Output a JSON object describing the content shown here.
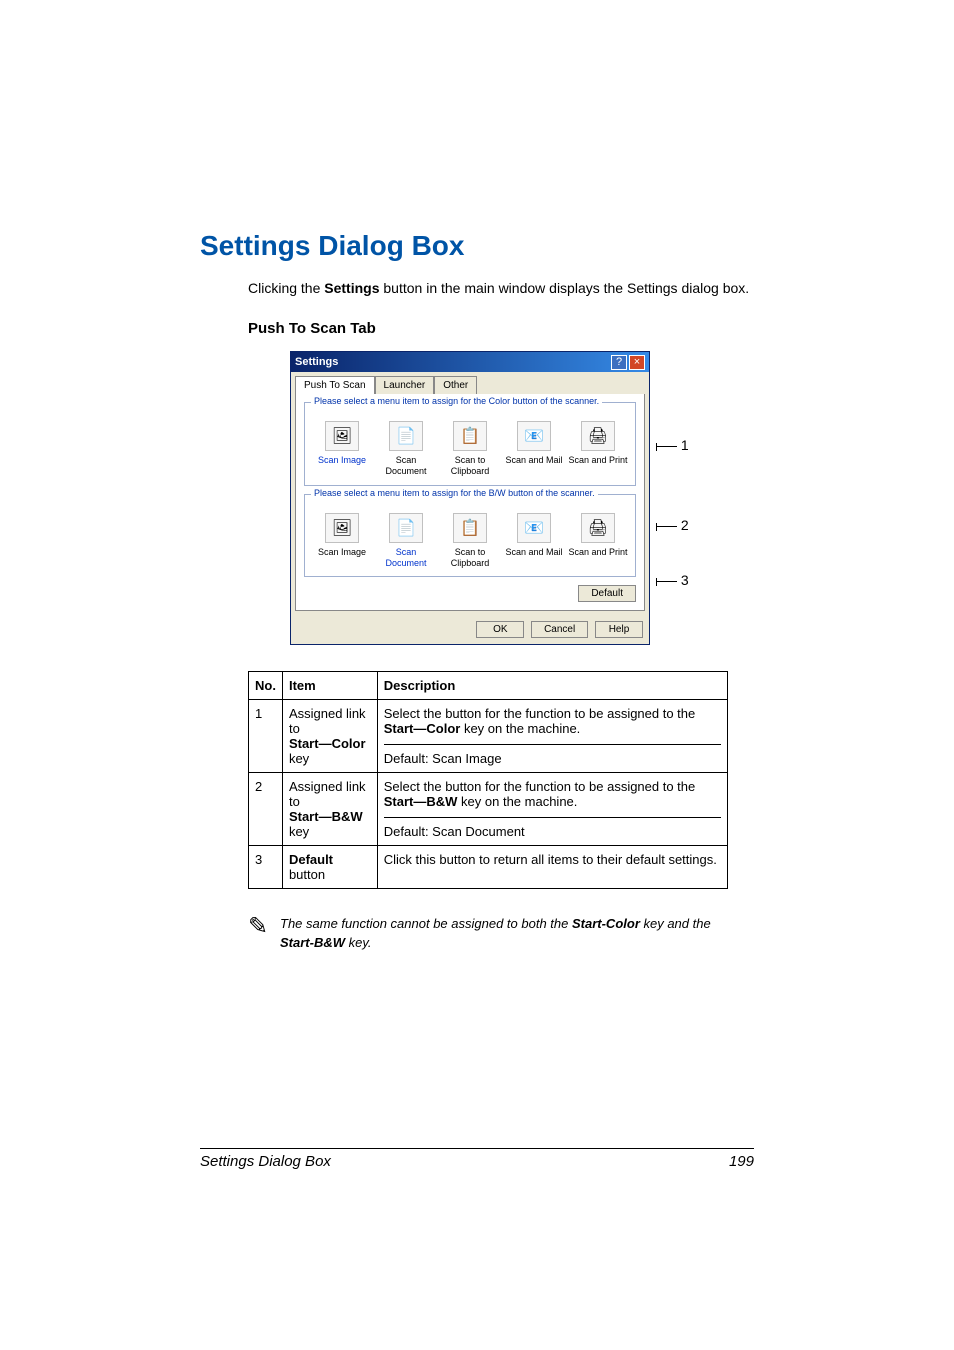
{
  "heading": "Settings Dialog Box",
  "intro_parts": {
    "pre": "Clicking the ",
    "bold": "Settings",
    "post": " button in the main window displays the Settings dialog box."
  },
  "subheading": "Push To Scan Tab",
  "dialog": {
    "title": "Settings",
    "help_glyph": "?",
    "close_glyph": "×",
    "tabs": [
      "Push To Scan",
      "Launcher",
      "Other"
    ],
    "group1_title": "Please select a menu item to assign for the Color button of the scanner.",
    "group2_title": "Please select a menu item to assign for the B/W button of the scanner.",
    "items": [
      {
        "icon": "🖼",
        "label": "Scan Image"
      },
      {
        "icon": "📄",
        "label": "Scan Document"
      },
      {
        "icon": "📋",
        "label": "Scan to Clipboard"
      },
      {
        "icon": "📧",
        "label": "Scan and Mail"
      },
      {
        "icon": "🖨",
        "label": "Scan and Print"
      }
    ],
    "default_btn": "Default",
    "ok": "OK",
    "cancel": "Cancel",
    "help": "Help"
  },
  "callouts": {
    "c1": "1",
    "c2": "2",
    "c3": "3"
  },
  "table": {
    "h_no": "No.",
    "h_item": "Item",
    "h_desc": "Description",
    "r1": {
      "no": "1",
      "item_line1": "Assigned link to ",
      "item_bold": "Start—Color",
      "item_line2": " key",
      "desc1a": "Select the button for the function to be assigned to the ",
      "desc1b": "Start—Color",
      "desc1c": " key on the machine.",
      "desc2": "Default: Scan Image"
    },
    "r2": {
      "no": "2",
      "item_line1": "Assigned link to ",
      "item_bold": "Start—B&W",
      "item_line2": " key",
      "desc1a": "Select the button for the function to be assigned to the ",
      "desc1b": "Start—B&W",
      "desc1c": " key on the machine.",
      "desc2": "Default: Scan Document"
    },
    "r3": {
      "no": "3",
      "item_bold": "Default",
      "item_after": " button",
      "desc": "Click this button to return all items to their default settings."
    }
  },
  "note": {
    "pre": "The same function cannot be assigned to both the ",
    "b1": "Start-Color",
    "mid": " key and the ",
    "b2": "Start-B&W",
    "post": " key."
  },
  "footer": {
    "left": "Settings Dialog Box",
    "right": "199"
  }
}
